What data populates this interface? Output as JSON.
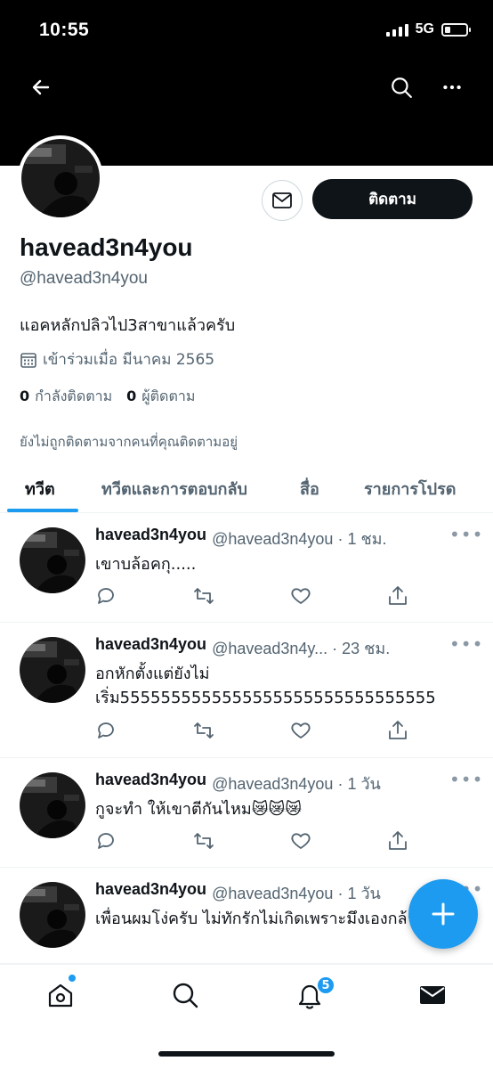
{
  "status_bar": {
    "time": "10:55",
    "network": "5G",
    "battery_level": 0.25
  },
  "header": {
    "back_icon": "arrow-left-icon",
    "search_icon": "search-icon",
    "more_icon": "more-horizontal-icon"
  },
  "profile": {
    "display_name": "havead3n4you",
    "handle": "@havead3n4you",
    "bio": "แอคหลักปลิวไป3สาขาแล้วครับ",
    "joined": "เข้าร่วมเมื่อ มีนาคม 2565",
    "following_count": "0",
    "following_label": "กำลังติดตาม",
    "followers_count": "0",
    "followers_label": "ผู้ติดตาม",
    "not_followed_note": "ยังไม่ถูกติดตามจากคนที่คุณติดตามอยู่",
    "follow_label": "ติดตาม",
    "message_icon": "envelope-icon"
  },
  "tabs": [
    {
      "label": "ทวีต",
      "active": true
    },
    {
      "label": "ทวีตและการตอบกลับ",
      "active": false
    },
    {
      "label": "สื่อ",
      "active": false
    },
    {
      "label": "รายการโปรด",
      "active": false
    }
  ],
  "tweets": [
    {
      "name": "havead3n4you",
      "meta": "@havead3n4you · 1 ชม.",
      "text": "เขาบล้อคกุ.....",
      "more": "•••"
    },
    {
      "name": "havead3n4you",
      "meta": "@havead3n4y... · 23 ชม.",
      "text": "อกหักตั้งแต่ยังไม่เริ่ม5555555555555555555555555555555",
      "more": "•••"
    },
    {
      "name": "havead3n4you",
      "meta": "@havead3n4you · 1 วัน",
      "text": "กูจะทำ ให้เขาตีกันไหม😿😿😿",
      "more": "•••"
    },
    {
      "name": "havead3n4you",
      "meta": "@havead3n4you · 1 วัน",
      "text": "เพื่อนผมโง่ครับ ไม่ทักรักไม่เกิดเพราะมึงเองกล้า",
      "more": "•••"
    }
  ],
  "bottom_nav": {
    "items": [
      "home-icon",
      "search-icon",
      "notifications-icon",
      "messages-icon"
    ],
    "notification_badge": "5"
  },
  "colors": {
    "accent": "#1d9bf0",
    "text": "#0f1419",
    "secondary": "#536471",
    "banner": "#000000"
  }
}
